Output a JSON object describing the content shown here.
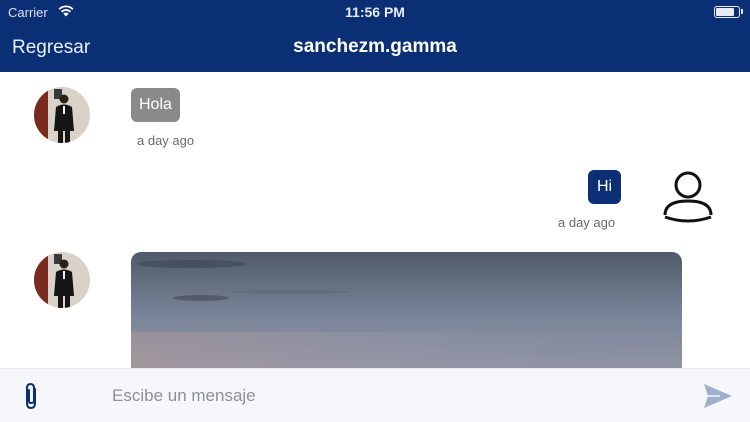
{
  "status_bar": {
    "carrier": "Carrier",
    "time": "11:56 PM",
    "wifi_icon": "wifi-icon",
    "battery_icon": "battery-icon"
  },
  "nav": {
    "back_label": "Regresar",
    "title": "sanchezm.gamma"
  },
  "messages": [
    {
      "direction": "incoming",
      "type": "text",
      "text": "Hola",
      "time": "a day ago",
      "avatar": "contact-avatar"
    },
    {
      "direction": "outgoing",
      "type": "text",
      "text": "Hi",
      "time": "a day ago",
      "avatar": "user-placeholder-icon"
    },
    {
      "direction": "incoming",
      "type": "image",
      "avatar": "contact-avatar"
    }
  ],
  "composer": {
    "placeholder": "Escibe un mensaje",
    "value": "",
    "attach_icon": "paperclip-icon",
    "send_icon": "send-icon"
  },
  "colors": {
    "nav_background": "#0b2f74",
    "incoming_bubble": "#8a8a8a",
    "outgoing_bubble": "#0b2f74",
    "send_icon": "#9fb0cc",
    "attach_icon": "#0b2f74"
  }
}
